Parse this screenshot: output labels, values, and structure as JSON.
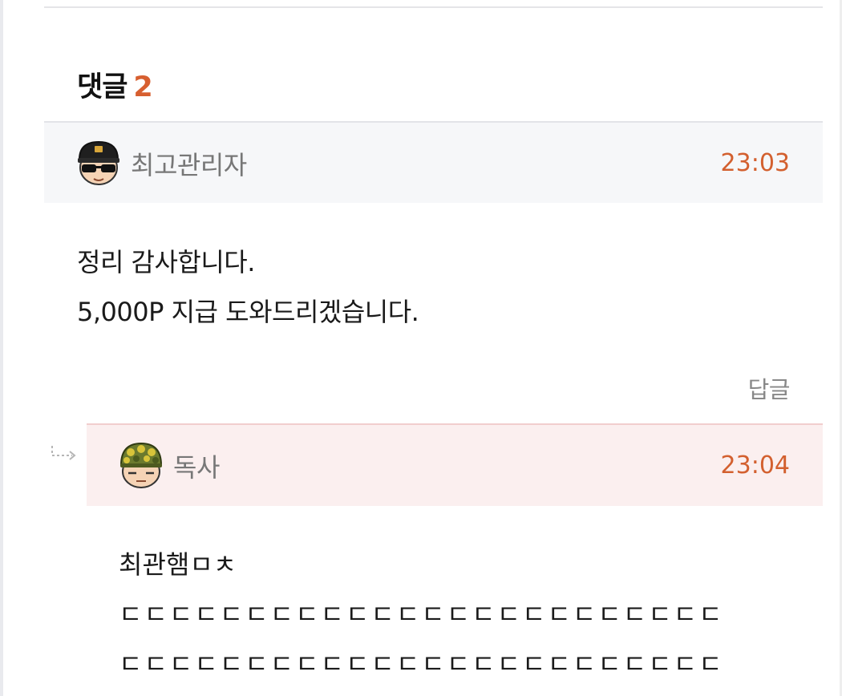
{
  "comments_section": {
    "title": "댓글",
    "count": "2"
  },
  "comments": [
    {
      "author": "최고관리자",
      "avatar_icon": "police-officer-sunglasses-icon",
      "time": "23:03",
      "body_lines": [
        "정리 감사합니다.",
        "5,000P 지급 도와드리겠습니다."
      ],
      "reply_label": "답글"
    }
  ],
  "replies": [
    {
      "author": "독사",
      "avatar_icon": "soldier-camo-helmet-icon",
      "time": "23:04",
      "body_lines": [
        "최관햄ㅁㅊ",
        "ㄷㄷㄷㄷㄷㄷㄷㄷㄷㄷㄷㄷㄷㄷㄷㄷㄷㄷㄷㄷㄷㄷㄷㄷ",
        "ㄷㄷㄷㄷㄷㄷㄷㄷㄷㄷㄷㄷㄷㄷㄷㄷㄷㄷㄷㄷㄷㄷㄷㄷ"
      ]
    }
  ],
  "colors": {
    "accent": "#d75f30",
    "header_bg": "#f6f7f9",
    "reply_header_bg": "#fbefef"
  }
}
